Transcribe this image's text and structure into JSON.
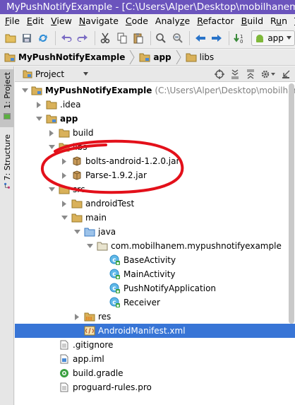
{
  "window": {
    "title": "MyPushNotifyExample - [C:\\Users\\Alper\\Desktop\\mobilhanem"
  },
  "menu": {
    "items": [
      {
        "pre": "",
        "u": "F",
        "post": "ile"
      },
      {
        "pre": "",
        "u": "E",
        "post": "dit"
      },
      {
        "pre": "",
        "u": "V",
        "post": "iew"
      },
      {
        "pre": "",
        "u": "N",
        "post": "avigate"
      },
      {
        "pre": "",
        "u": "C",
        "post": "ode"
      },
      {
        "pre": "Analy",
        "u": "z",
        "post": "e"
      },
      {
        "pre": "",
        "u": "R",
        "post": "efactor"
      },
      {
        "pre": "",
        "u": "B",
        "post": "uild"
      },
      {
        "pre": "R",
        "u": "u",
        "post": "n"
      },
      {
        "pre": "",
        "u": "T",
        "post": "ools"
      }
    ]
  },
  "toolbar": {
    "run_config_label": "app",
    "icons": [
      "open-folder-icon",
      "save-icon",
      "sync-icon",
      "undo-icon",
      "redo-icon",
      "cut-icon",
      "copy-icon",
      "paste-icon",
      "find-icon",
      "replace-icon",
      "back-icon",
      "forward-icon",
      "make-project-icon"
    ]
  },
  "breadcrumb": {
    "items": [
      "MyPushNotifyExample",
      "app",
      "libs"
    ]
  },
  "sidebar": {
    "project_tab": "1: Project",
    "structure_tab": "7: Structure"
  },
  "panel": {
    "view_label": "Project"
  },
  "tree": [
    {
      "label": "MyPushNotifyExample",
      "path": "(C:\\Users\\Alper\\Desktop\\mobilhanem",
      "depth": 0,
      "expanded": true,
      "icon": "module-folder",
      "bold": true
    },
    {
      "label": ".idea",
      "depth": 1,
      "expanded": false,
      "icon": "folder"
    },
    {
      "label": "app",
      "depth": 1,
      "expanded": true,
      "icon": "module-folder",
      "bold": true
    },
    {
      "label": "build",
      "depth": 2,
      "expanded": false,
      "icon": "folder"
    },
    {
      "label": "libs",
      "depth": 2,
      "expanded": true,
      "icon": "folder"
    },
    {
      "label": "bolts-android-1.2.0.jar",
      "depth": 3,
      "expanded": false,
      "icon": "jar"
    },
    {
      "label": "Parse-1.9.2.jar",
      "depth": 3,
      "expanded": false,
      "icon": "jar"
    },
    {
      "label": "src",
      "depth": 2,
      "expanded": true,
      "icon": "folder"
    },
    {
      "label": "androidTest",
      "depth": 3,
      "expanded": false,
      "icon": "folder"
    },
    {
      "label": "main",
      "depth": 3,
      "expanded": true,
      "icon": "folder"
    },
    {
      "label": "java",
      "depth": 4,
      "expanded": true,
      "icon": "source-folder"
    },
    {
      "label": "com.mobilhanem.mypushnotifyexample",
      "depth": 5,
      "expanded": true,
      "icon": "package"
    },
    {
      "label": "BaseActivity",
      "depth": 6,
      "icon": "class"
    },
    {
      "label": "MainActivity",
      "depth": 6,
      "icon": "class"
    },
    {
      "label": "PushNotifyApplication",
      "depth": 6,
      "icon": "class"
    },
    {
      "label": "Receiver",
      "depth": 6,
      "icon": "class"
    },
    {
      "label": "res",
      "depth": 4,
      "expanded": false,
      "icon": "res-folder"
    },
    {
      "label": "AndroidManifest.xml",
      "depth": 4,
      "icon": "xml",
      "selected": true
    },
    {
      "label": ".gitignore",
      "depth": 2,
      "icon": "file"
    },
    {
      "label": "app.iml",
      "depth": 2,
      "icon": "iml"
    },
    {
      "label": "build.gradle",
      "depth": 2,
      "icon": "gradle"
    },
    {
      "label": "proguard-rules.pro",
      "depth": 2,
      "icon": "file"
    }
  ],
  "colors": {
    "title_bar": "#6b54bd",
    "selection": "#3875d6",
    "annotation": "#e3101a",
    "folder": "#d9b15a",
    "class_icon": "#3a9fd6"
  }
}
